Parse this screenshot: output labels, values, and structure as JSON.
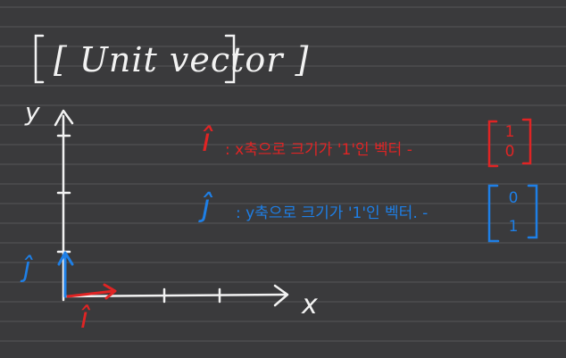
{
  "title": "[ Unit vector ]",
  "axis": {
    "y_label": "y",
    "x_label": "x"
  },
  "symbols": {
    "i_hat": "î",
    "j_hat": "ĵ"
  },
  "definitions": {
    "i_text": ": x축으로 크기가 '1'인 벡터 -",
    "j_text": ": y축으로 크기가 '1'인 벡터. -"
  },
  "matrices": {
    "i": {
      "top": "1",
      "bottom": "0"
    },
    "j": {
      "top": "0",
      "bottom": "1"
    }
  },
  "colors": {
    "background": "#3a3a3c",
    "ruling": "#555558",
    "ink": "#f2f2f2",
    "red": "#e02424",
    "blue": "#1e7fe6"
  }
}
